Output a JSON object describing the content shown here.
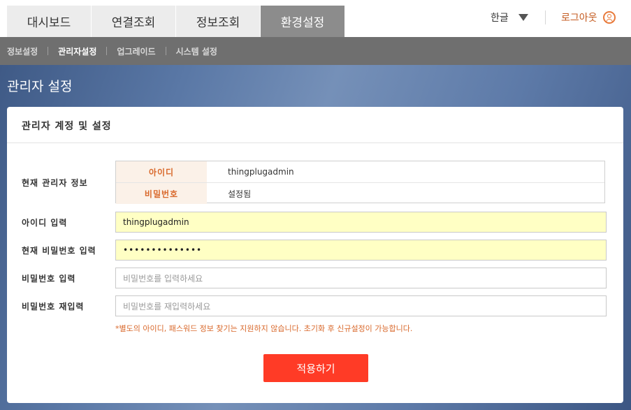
{
  "header": {
    "tabs": [
      {
        "label": "대시보드",
        "active": false
      },
      {
        "label": "연결조회",
        "active": false
      },
      {
        "label": "정보조회",
        "active": false
      },
      {
        "label": "환경설정",
        "active": true
      }
    ],
    "language": "한글",
    "language_icon": "triangle-down-icon",
    "logout": "로그아웃",
    "logout_icon": "user-circle-icon"
  },
  "subnav": {
    "items": [
      {
        "label": "정보설정",
        "active": false
      },
      {
        "label": "관리자설정",
        "active": true
      },
      {
        "label": "업그레이드",
        "active": false
      },
      {
        "label": "시스템 설정",
        "active": false
      }
    ]
  },
  "page": {
    "title": "관리자 설정"
  },
  "card": {
    "title": "관리자 계정 및 설정",
    "current_info_label": "현재 관리자 정보",
    "info": [
      {
        "key": "아이디",
        "value": "thingplugadmin"
      },
      {
        "key": "비밀번호",
        "value": "설정됨"
      }
    ],
    "id_label": "아이디 입력",
    "id_value": "thingplugadmin",
    "current_pw_label": "현재 비밀번호 입력",
    "current_pw_value": "••••••••••••••",
    "new_pw_label": "비밀번호 입력",
    "new_pw_placeholder": "비밀번호를 입력하세요",
    "confirm_pw_label": "비밀번호 재입력",
    "confirm_pw_placeholder": "비밀번호를 재입력하세요",
    "notice": "*별도의 아이디, 패스워드 정보 찾기는 지원하지 않습니다. 초기화 후 신규설정이 가능합니다.",
    "apply_button": "적용하기"
  },
  "colors": {
    "accent": "#ff3b26",
    "highlight_text": "#d9692c",
    "input_filled_bg": "#ffffc4"
  }
}
